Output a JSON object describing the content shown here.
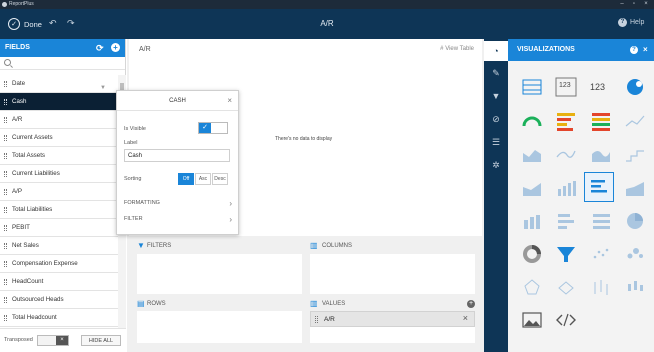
{
  "window": {
    "app_title": "ReportPlus"
  },
  "topbar": {
    "done_label": "Done",
    "doc_title": "A/R",
    "help_label": "Help"
  },
  "fields": {
    "header": "FIELDS",
    "items": [
      {
        "label": "Date"
      },
      {
        "label": "Cash"
      },
      {
        "label": "A/R"
      },
      {
        "label": "Current Assets"
      },
      {
        "label": "Total Assets"
      },
      {
        "label": "Current Liabilities"
      },
      {
        "label": "A/P"
      },
      {
        "label": "Total Liabilities"
      },
      {
        "label": "PEBIT"
      },
      {
        "label": "Net Sales"
      },
      {
        "label": "Compensation Expense"
      },
      {
        "label": "HeadCount"
      },
      {
        "label": "Outsourced Heads"
      },
      {
        "label": "Total Headcount"
      }
    ],
    "transposed_label": "Transposed",
    "hide_all_label": "HIDE ALL"
  },
  "preview": {
    "title": "A/R",
    "view_table": "View Table",
    "no_data": "There's no data to display"
  },
  "popup": {
    "title": "CASH",
    "visible_label": "Is Visible",
    "label_label": "Label",
    "label_value": "Cash",
    "sorting_label": "Sorting",
    "sort_options": [
      "Off",
      "Asc",
      "Desc"
    ],
    "formatting": "FORMATTING",
    "filter": "FILTER"
  },
  "wells": {
    "filters": "FILTERS",
    "columns": "COLUMNS",
    "rows": "ROWS",
    "values": "VALUES",
    "values_item": "A/R"
  },
  "viz": {
    "header": "VISUALIZATIONS",
    "tile_text": {
      "t2": "123",
      "t3": "123"
    }
  },
  "colors": {
    "accent": "#1a85d8",
    "topbar": "#0e3556",
    "selected_row": "#0b2034"
  }
}
